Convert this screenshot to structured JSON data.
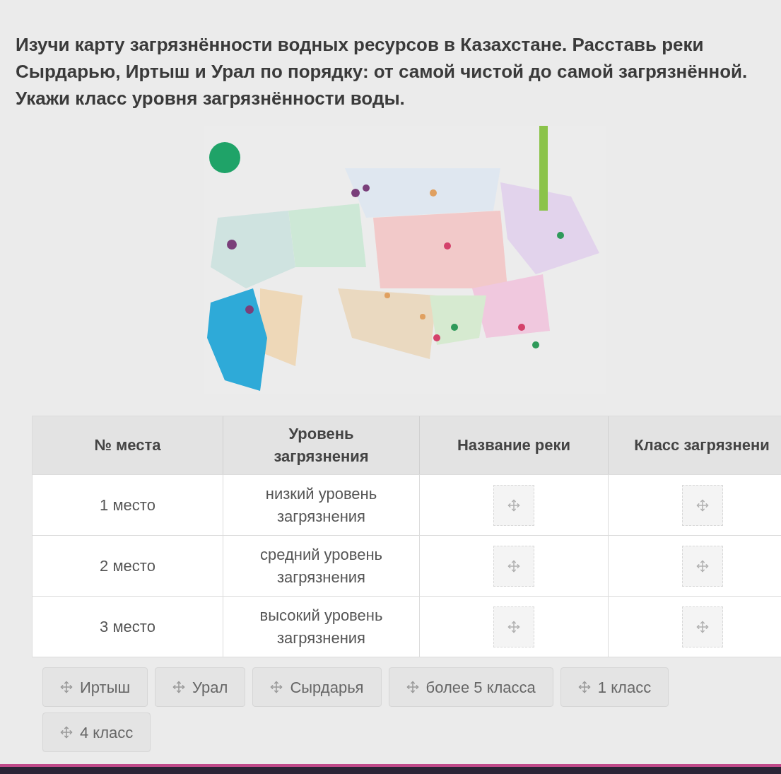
{
  "question": "Изучи карту загрязнённости водных ресурсов в Казахстане. Расставь реки Сырдарью, Иртыш и Урал по порядку: от самой чистой до самой загрязнённой. Укажи класс уровня загрязнённости воды.",
  "table": {
    "columns": [
      "№ места",
      "Уровень загрязнения",
      "Название реки",
      "Класс загрязнени"
    ],
    "rows": [
      {
        "place": "1 место",
        "level": "низкий уровень загрязнения"
      },
      {
        "place": "2 место",
        "level": "средний уровень загрязнения"
      },
      {
        "place": "3 место",
        "level": "высокий уровень загрязнения"
      }
    ]
  },
  "options": [
    "Иртыш",
    "Урал",
    "Сырдарья",
    "более 5 класса",
    "1 класс",
    "4 класс"
  ]
}
